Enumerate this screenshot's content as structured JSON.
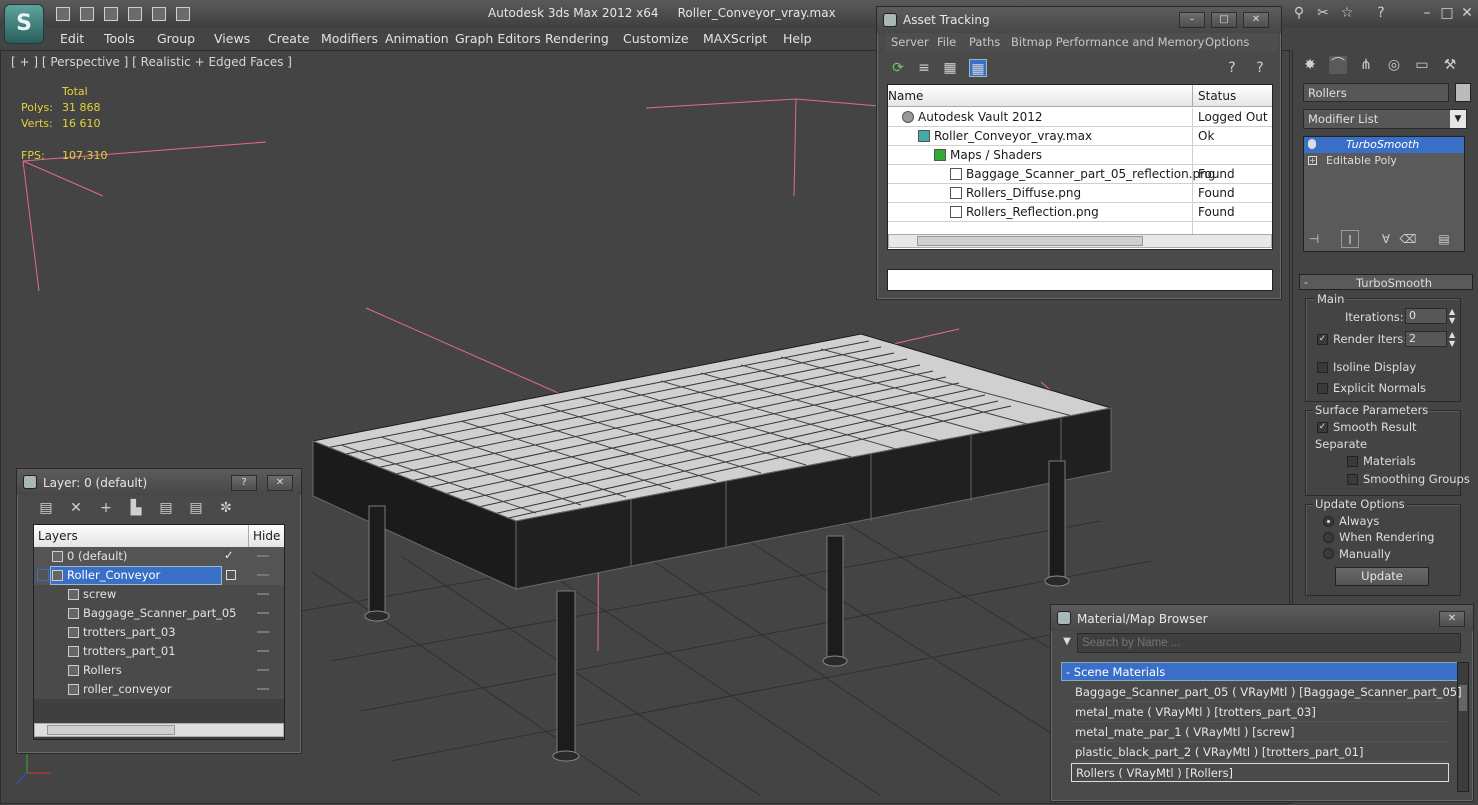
{
  "app": {
    "title": "Autodesk 3ds Max  2012 x64",
    "file": "Roller_Conveyor_vray.max",
    "logo": "3ds Max logo"
  },
  "menu": [
    "Edit",
    "Tools",
    "Group",
    "Views",
    "Create",
    "Modifiers",
    "Animation",
    "Graph Editors",
    "Rendering",
    "Customize",
    "MAXScript",
    "Help"
  ],
  "viewport": {
    "label": "[ + ] [ Perspective ] [ Realistic + Edged Faces ]",
    "stats": {
      "total_label": "Total",
      "polys_label": "Polys:",
      "polys": "31 868",
      "verts_label": "Verts:",
      "verts": "16 610",
      "fps_label": "FPS:",
      "fps": "107,310"
    }
  },
  "asset_tracking": {
    "title": "Asset Tracking",
    "menu": [
      "Server",
      "File",
      "Paths",
      "Bitmap Performance and Memory",
      "Options"
    ],
    "columns": [
      "Name",
      "Status"
    ],
    "rows": [
      {
        "name": "Autodesk Vault 2012",
        "status": "Logged Out ..."
      },
      {
        "name": "Roller_Conveyor_vray.max",
        "status": "Ok"
      },
      {
        "name": "Maps / Shaders",
        "status": ""
      },
      {
        "name": "Baggage_Scanner_part_05_reflection.png",
        "status": "Found"
      },
      {
        "name": "Rollers_Diffuse.png",
        "status": "Found"
      },
      {
        "name": "Rollers_Reflection.png",
        "status": "Found"
      }
    ]
  },
  "layer_window": {
    "title": "Layer: 0 (default)",
    "columns": [
      "Layers",
      "Hide"
    ],
    "layers": [
      {
        "name": "0 (default)"
      },
      {
        "name": "Roller_Conveyor"
      },
      {
        "name": "screw"
      },
      {
        "name": "Baggage_Scanner_part_05"
      },
      {
        "name": "trotters_part_03"
      },
      {
        "name": "trotters_part_01"
      },
      {
        "name": "Rollers"
      },
      {
        "name": "roller_conveyor"
      }
    ]
  },
  "command_panel": {
    "object_name": "Rollers",
    "modifier_list": "Modifier List",
    "stack": [
      "TurboSmooth",
      "Editable Poly"
    ],
    "rollout_title": "TurboSmooth",
    "main_label": "Main",
    "iterations_label": "Iterations:",
    "iterations": "0",
    "render_iters_label": "Render Iters:",
    "render_iters": "2",
    "isoline": "Isoline Display",
    "explicit_normals": "Explicit Normals",
    "surface_params": "Surface Parameters",
    "smooth_result": "Smooth Result",
    "separate": "Separate",
    "materials": "Materials",
    "smoothing_groups": "Smoothing Groups",
    "update_options": "Update Options",
    "always": "Always",
    "when_rendering": "When Rendering",
    "manually": "Manually",
    "update_button": "Update"
  },
  "material_browser": {
    "title": "Material/Map Browser",
    "search_placeholder": "Search by Name ...",
    "section": "- Scene Materials",
    "materials": [
      "Baggage_Scanner_part_05  ( VRayMtl )  [Baggage_Scanner_part_05]",
      "metal_mate  ( VRayMtl )  [trotters_part_03]",
      "metal_mate_par_1  ( VRayMtl )  [screw]",
      "plastic_black_part_2  ( VRayMtl )  [trotters_part_01]",
      "Rollers  ( VRayMtl )  [Rollers]"
    ]
  },
  "colors": {
    "selection": "#3a6fc8",
    "stats": "#e5d23a",
    "light_lines": "#e46a8c"
  }
}
